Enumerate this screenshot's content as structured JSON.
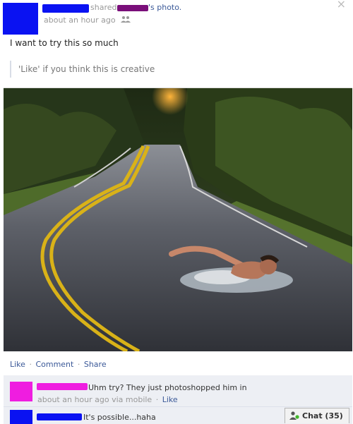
{
  "post": {
    "action_text": "shared",
    "photo_suffix": "'s photo.",
    "timestamp": "about an hour ago",
    "audience_icon": "friends-icon",
    "message": "I want to try this so much",
    "quote": "'Like' if you think this is creative"
  },
  "photo": {
    "subject": "man-swimming-on-road"
  },
  "actions": {
    "like": "Like",
    "comment": "Comment",
    "share": "Share",
    "separator": "·"
  },
  "comments": [
    {
      "text": "Uhm try? They just photoshopped him in",
      "timestamp": "about an hour ago via mobile",
      "like": "Like",
      "dot": "·"
    },
    {
      "text": "It's possible...haha"
    }
  ],
  "chat": {
    "label": "Chat (35)",
    "status_color": "#42b72a"
  },
  "colors": {
    "link": "#3b5998",
    "redact_blue": "#0a12f2",
    "redact_purple": "#7a0f7a",
    "redact_magenta": "#ef1de0"
  }
}
